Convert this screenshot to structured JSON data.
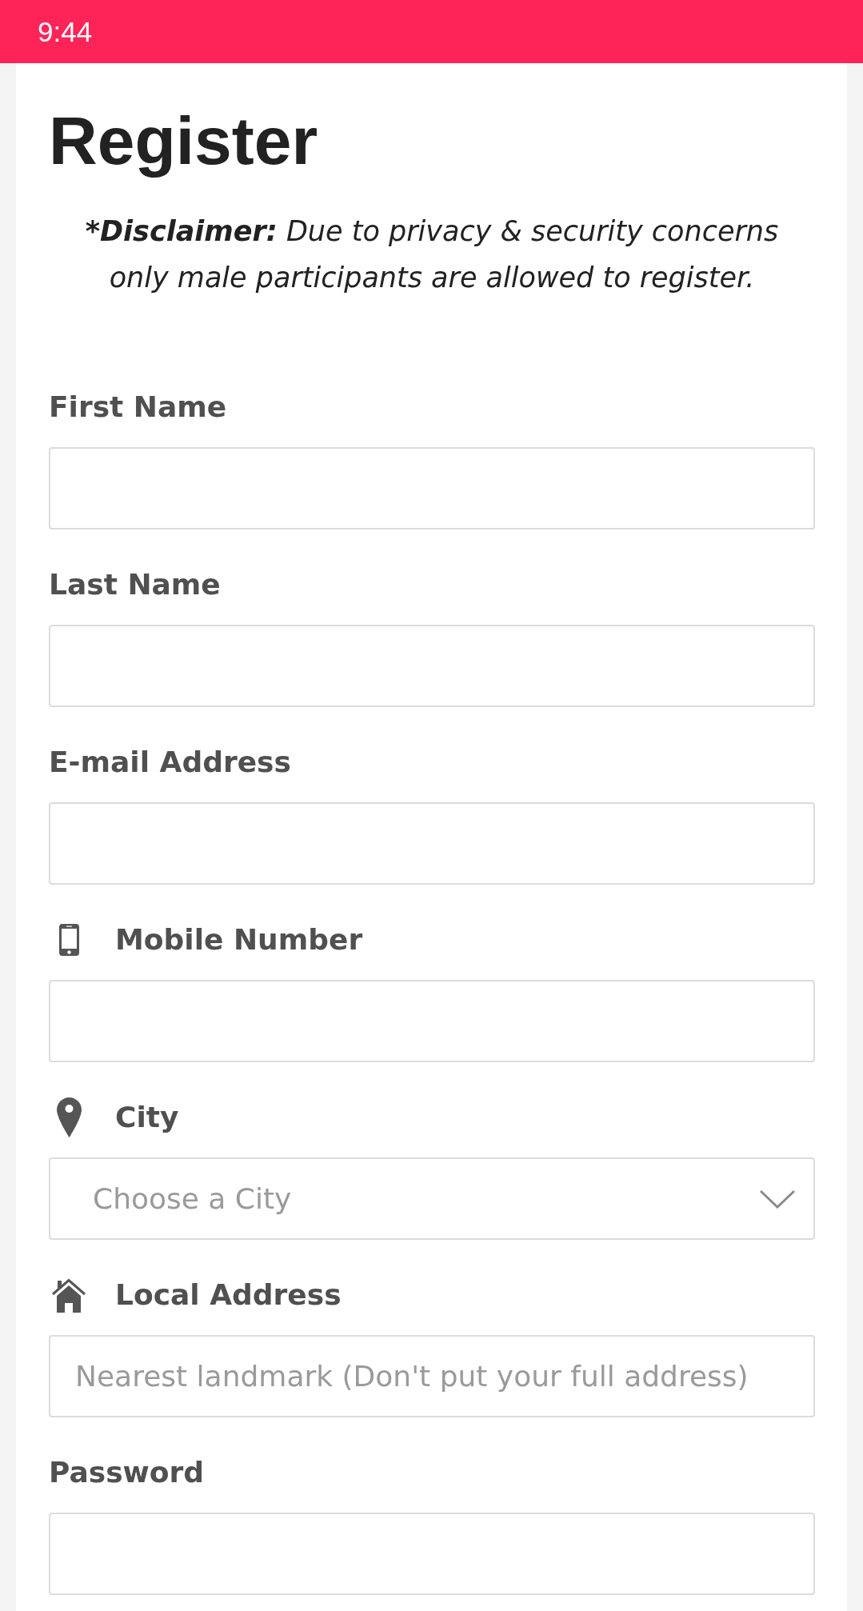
{
  "status_bar": {
    "time": "9:44"
  },
  "page": {
    "title": "Register"
  },
  "disclaimer": {
    "label": "*Disclaimer:",
    "text": "Due to privacy & security concerns only male participants are allowed to register."
  },
  "fields": [
    {
      "kind": "plain",
      "label": "First Name"
    },
    {
      "kind": "plain",
      "label": "Last Name"
    },
    {
      "kind": "plain",
      "label": "E-mail Address"
    },
    {
      "kind": "phone",
      "label": "Mobile Number"
    },
    {
      "kind": "location",
      "label": "City",
      "placeholder": "Choose a City"
    },
    {
      "kind": "address",
      "label": "Local Address",
      "placeholder": "Nearest landmark (Don't put your full address)"
    },
    {
      "kind": "plain",
      "label": "Password"
    }
  ]
}
